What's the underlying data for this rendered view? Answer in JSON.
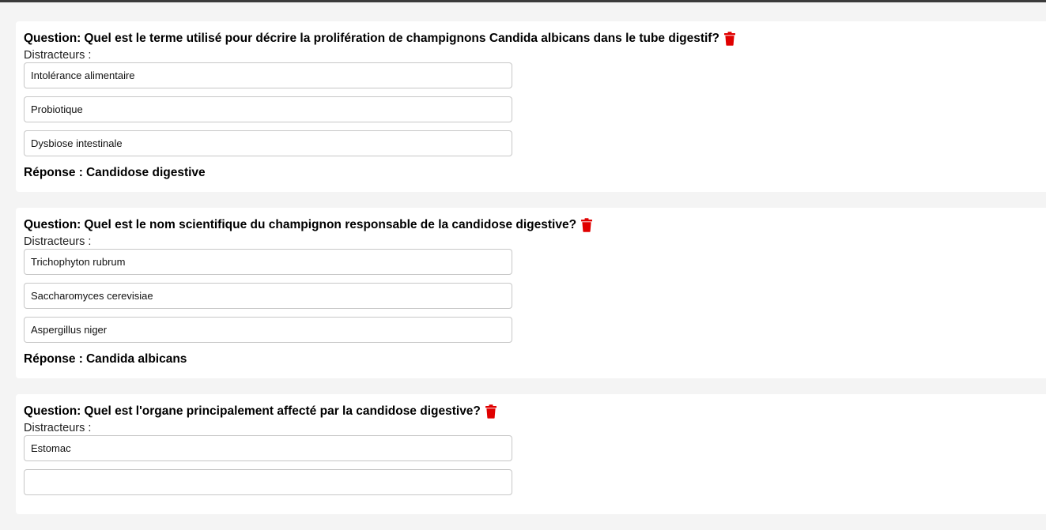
{
  "labels": {
    "question_prefix": "Question:",
    "distractors": "Distracteurs :",
    "answer_prefix": "Réponse :"
  },
  "icons": {
    "delete": "trash-icon",
    "delete_color": "#e00000"
  },
  "questions": [
    {
      "text": "Quel est le terme utilisé pour décrire la prolifération de champignons Candida albicans dans le tube digestif?",
      "distractors": [
        "Intolérance alimentaire",
        "Probiotique",
        "Dysbiose intestinale"
      ],
      "answer": "Candidose digestive"
    },
    {
      "text": "Quel est le nom scientifique du champignon responsable de la candidose digestive?",
      "distractors": [
        "Trichophyton rubrum",
        "Saccharomyces cerevisiae",
        "Aspergillus niger"
      ],
      "answer": "Candida albicans"
    },
    {
      "text": "Quel est l'organe principalement affecté par la candidose digestive?",
      "distractors": [
        "Estomac",
        ""
      ],
      "answer": ""
    }
  ]
}
